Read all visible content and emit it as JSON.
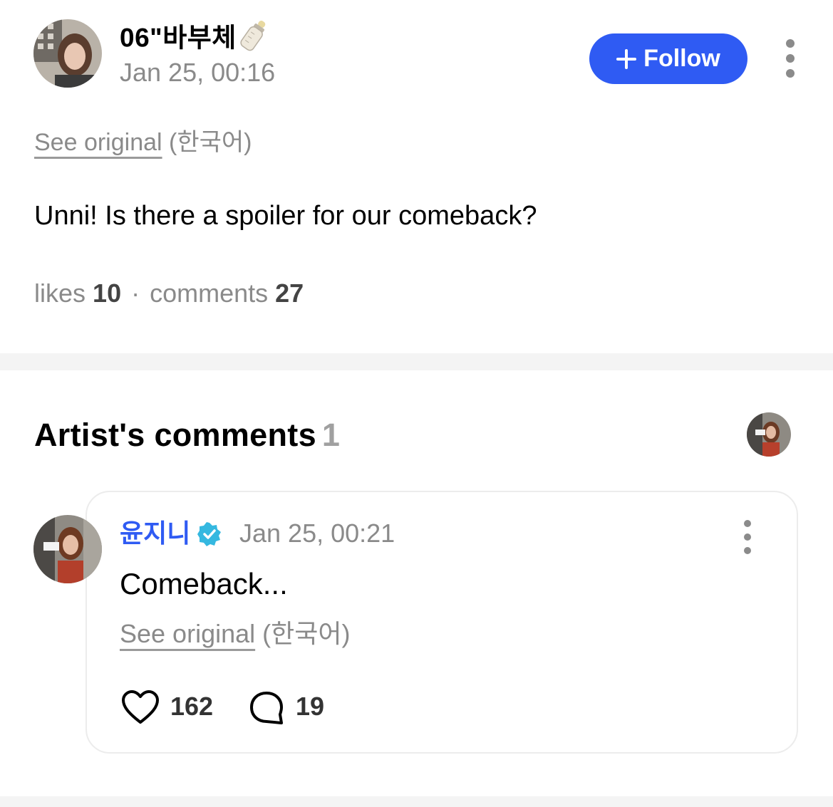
{
  "post": {
    "username": "06\"바부체",
    "username_emoji_icon": "baby-bottle-icon",
    "timestamp": "Jan 25, 00:16",
    "follow_label": "Follow",
    "see_original_label": "See original",
    "original_language": "(한국어)",
    "body": "Unni! Is there a spoiler for our comeback?",
    "likes_label": "likes",
    "likes_count": "10",
    "separator": "·",
    "comments_label": "comments",
    "comments_count": "27"
  },
  "artist_comments": {
    "title": "Artist's comments",
    "count": "1",
    "comment": {
      "author": "윤지니",
      "verified_icon": "verified-badge-icon",
      "timestamp": "Jan 25, 00:21",
      "body": "Comeback...",
      "see_original_label": "See original",
      "original_language": "(한국어)",
      "likes_count": "162",
      "replies_count": "19"
    }
  },
  "colors": {
    "accent": "#2f5bf3",
    "muted_text": "#8a8a8a",
    "divider": "#f4f4f4",
    "verified": "#35b8e0"
  }
}
